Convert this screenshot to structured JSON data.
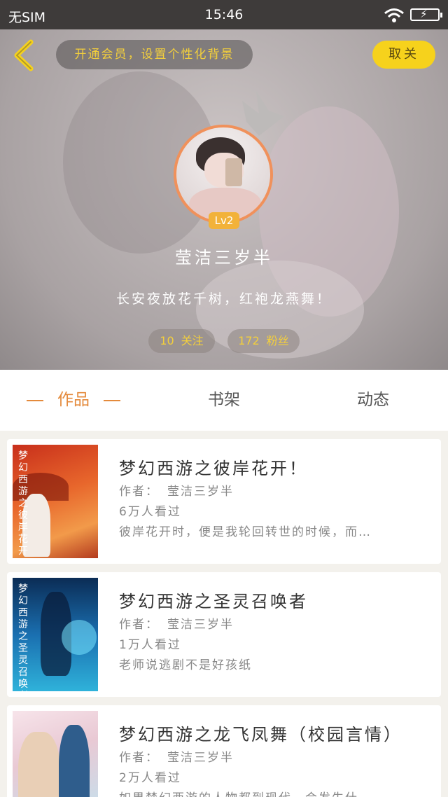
{
  "status_bar": {
    "carrier": "无SIM",
    "time": "15:46"
  },
  "header": {
    "promo_text": "开通会员，设置个性化背景",
    "cancel_label": "取关",
    "level": "Lv2",
    "username": "莹洁三岁半",
    "motto": "长安夜放花千树，红袍龙燕舞！",
    "following": {
      "count": "10",
      "label": "关注"
    },
    "fans": {
      "count": "172",
      "label": "粉丝"
    }
  },
  "tabs": [
    {
      "label": "作品",
      "active": true
    },
    {
      "label": "书架",
      "active": false
    },
    {
      "label": "动态",
      "active": false
    }
  ],
  "books": [
    {
      "title": "梦幻西游之彼岸花开！",
      "author_label": "作者：",
      "author": "莹洁三岁半",
      "views": "6万人看过",
      "desc": "彼岸花开时，便是我轮回转世的时候，而…",
      "cover_text": "梦幻西游之彼岸花开"
    },
    {
      "title": "梦幻西游之圣灵召唤者",
      "author_label": "作者：",
      "author": "莹洁三岁半",
      "views": "1万人看过",
      "desc": "老师说逃剧不是好孩纸",
      "cover_text": "梦幻西游之圣灵召唤者"
    },
    {
      "title": "梦幻西游之龙飞凤舞（校园言情）",
      "author_label": "作者：",
      "author": "莹洁三岁半",
      "views": "2万人看过",
      "desc": "如果梦幻西游的人物都到现代，会发生什…",
      "cover_text": ""
    }
  ],
  "colors": {
    "accent": "#e48a3c",
    "promo": "#f3cf3c",
    "cancel_bg": "#f6d21c",
    "avatar_ring": "#f0915b"
  }
}
